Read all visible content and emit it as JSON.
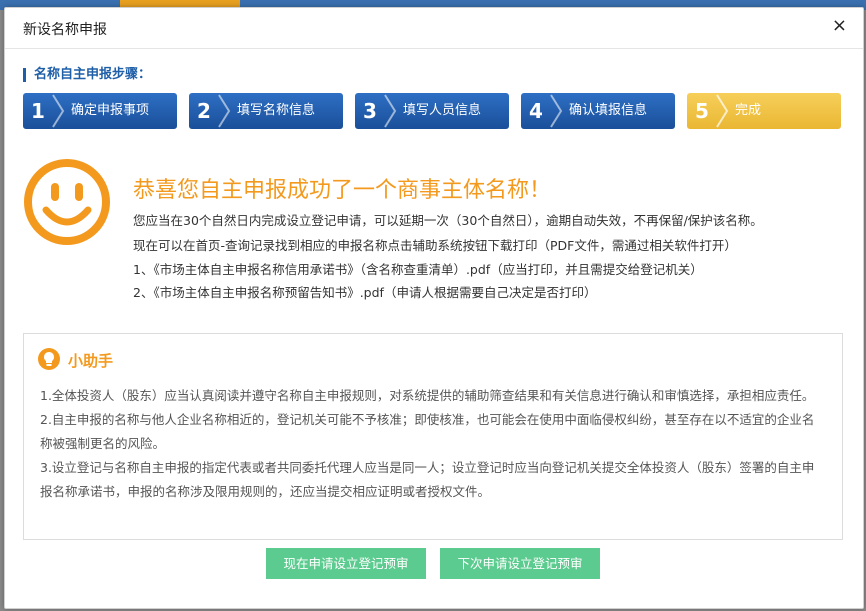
{
  "dialog": {
    "title": "新设名称申报",
    "close": "×"
  },
  "steps": {
    "label": "名称自主申报步骤：",
    "items": [
      {
        "num": "1",
        "label": "确定申报事项",
        "state": "active"
      },
      {
        "num": "2",
        "label": "填写名称信息",
        "state": "active"
      },
      {
        "num": "3",
        "label": "填写人员信息",
        "state": "active"
      },
      {
        "num": "4",
        "label": "确认填报信息",
        "state": "active"
      },
      {
        "num": "5",
        "label": "完成",
        "state": "current"
      }
    ]
  },
  "result": {
    "icon": "smiley-icon",
    "title": "恭喜您自主申报成功了一个商事主体名称！",
    "lines": [
      "您应当在30个自然日内完成设立登记申请，可以延期一次（30个自然日），逾期自动失效，不再保留/保护该名称。",
      "现在可以在首页-查询记录找到相应的申报名称点击辅助系统按钮下载打印（PDF文件，需通过相关软件打开）",
      "1、《市场主体自主申报名称信用承诺书》（含名称查重清单）.pdf（应当打印，并且需提交给登记机关）",
      "2、《市场主体自主申报名称预留告知书》.pdf（申请人根据需要自己决定是否打印）"
    ]
  },
  "helper": {
    "icon": "lightbulb-icon",
    "title": "小助手",
    "paragraphs": [
      "1.全体投资人（股东）应当认真阅读并遵守名称自主申报规则，对系统提供的辅助筛查结果和有关信息进行确认和审慎选择，承担相应责任。",
      "2.自主申报的名称与他人企业名称相近的，登记机关可能不予核准；即使核准，也可能会在使用中面临侵权纠纷，甚至存在以不适宜的企业名称被强制更名的风险。",
      "3.设立登记与名称自主申报的指定代表或者共同委托代理人应当是同一人；设立登记时应当向登记机关提交全体投资人（股东）签署的自主申报名称承诺书，申报的名称涉及限用规则的，还应当提交相应证明或者授权文件。"
    ]
  },
  "buttons": {
    "apply_now": "现在申请设立登记预审",
    "apply_later": "下次申请设立登记预审"
  },
  "colors": {
    "step_blue": "#1f5fa8",
    "step_done": "#f0c040",
    "accent_orange": "#f39a1e",
    "button_green": "#5ccb8f"
  }
}
